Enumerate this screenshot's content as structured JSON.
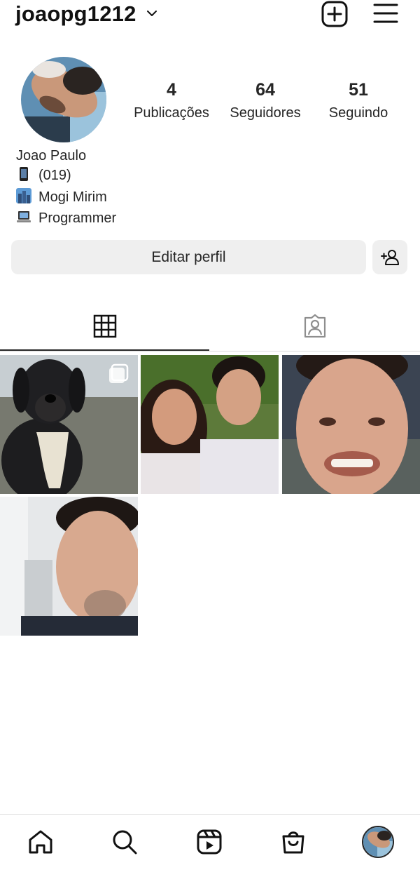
{
  "header": {
    "username": "joaopg1212",
    "icons": [
      "chevron-down-icon",
      "new-post-icon",
      "menu-icon"
    ]
  },
  "profile": {
    "stats": [
      {
        "value": "4",
        "label": "Publicações"
      },
      {
        "value": "64",
        "label": "Seguidores"
      },
      {
        "value": "51",
        "label": "Seguindo"
      }
    ],
    "name": "Joao Paulo",
    "bio_lines": [
      {
        "icon": "mobile-phone-icon",
        "text": "(019)"
      },
      {
        "icon": "cityscape-icon",
        "text": "Mogi Mirim"
      },
      {
        "icon": "laptop-icon",
        "text": "Programmer"
      }
    ],
    "edit_button_label": "Editar perfil"
  },
  "tabs": [
    {
      "icon": "grid-icon",
      "active": true
    },
    {
      "icon": "tagged-icon",
      "active": false
    }
  ],
  "posts": [
    {
      "subject": "dog",
      "multiple": true
    },
    {
      "subject": "selfie-two-people",
      "multiple": false
    },
    {
      "subject": "selfie-smile",
      "multiple": false
    },
    {
      "subject": "selfie-portrait",
      "multiple": false
    }
  ],
  "bottom_nav": [
    "home-icon",
    "search-icon",
    "reels-icon",
    "shop-icon",
    "profile-avatar"
  ],
  "colors": {
    "text": "#262626",
    "button_bg": "#efefef",
    "divider": "#dbdbdb",
    "background": "#ffffff"
  }
}
